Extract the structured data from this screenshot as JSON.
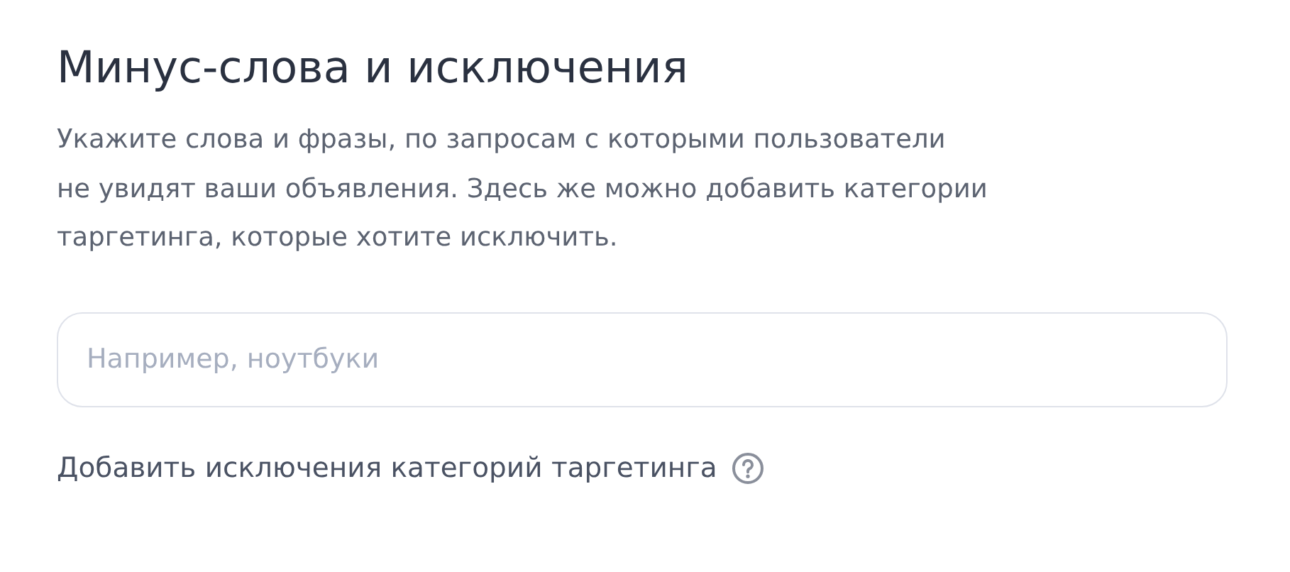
{
  "title": "Минус-слова и исключения",
  "description": "Укажите слова и фразы, по запросам с которыми пользователи\nне увидят ваши объявления. Здесь же можно добавить категории\nтаргетинга, которые хотите исключить.",
  "search": {
    "placeholder": "Например, ноутбуки"
  },
  "link": {
    "label": "Добавить исключения категорий таргетинга"
  }
}
